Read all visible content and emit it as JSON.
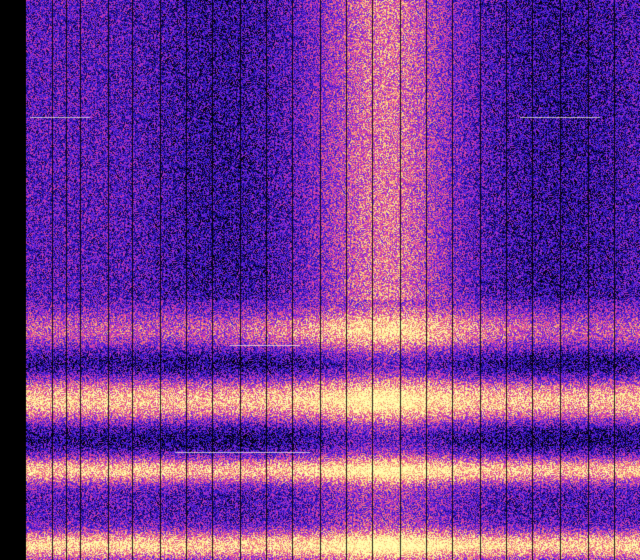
{
  "image": {
    "kind": "spectrogram",
    "palette": [
      "#000000",
      "#1a0a8c",
      "#3b1ed6",
      "#8a2bd8",
      "#d63ca6",
      "#f2807a",
      "#ffd98a",
      "#ffffb0"
    ],
    "background": "#000000",
    "bands": [
      {
        "level": "high",
        "label_visible": false
      },
      {
        "level": "high",
        "label_visible": false
      },
      {
        "level": "high",
        "label_visible": false
      }
    ]
  }
}
